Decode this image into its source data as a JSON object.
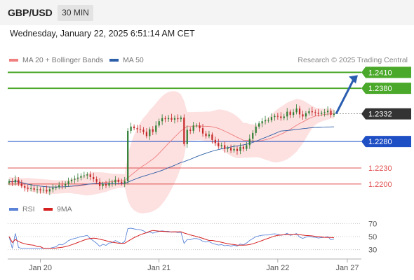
{
  "header": {
    "symbol": "GBP/USD",
    "timeframe": "30 MIN"
  },
  "datetime": "Wednesday, January 22, 2025 6:51:14 AM CET",
  "legend": {
    "ma20_label": "MA 20 + Bollinger Bands",
    "ma50_label": "MA 50",
    "rsi_label": "RSI",
    "rsi_ma_label": "9MA"
  },
  "copyright": "Research © 2025 Trading Central",
  "colors": {
    "ma20": "#f08080",
    "ma50": "#2d5fa8",
    "bollinger_fill": "#fde0e0",
    "resistance": "#4aa82a",
    "support": "#1f4fc4",
    "support_red": "#e05050",
    "current": "#333333",
    "rsi": "#5b84d8",
    "rsi_ma": "#d62020",
    "candle_up": "#2e7d32",
    "candle_down": "#c62828",
    "arrow": "#2a5db0"
  },
  "chart_data": [
    {
      "type": "candlestick",
      "title": "GBP/USD 30 MIN",
      "x_labels": [
        "Jan 20",
        "Jan 21",
        "Jan 22",
        "Jan 27"
      ],
      "ylim": [
        1.218,
        1.2425
      ],
      "series": [
        {
          "name": "GBP/USD",
          "close": [
            1.2205,
            1.2203,
            1.2208,
            1.2201,
            1.2196,
            1.2193,
            1.2191,
            1.2192,
            1.2189,
            1.219,
            1.2188,
            1.2189,
            1.2186,
            1.219,
            1.2193,
            1.2194,
            1.2198,
            1.2197,
            1.22,
            1.2205,
            1.2208,
            1.221,
            1.2212,
            1.2215,
            1.2216,
            1.2218,
            1.2213,
            1.2209,
            1.2204,
            1.2196,
            1.22,
            1.2197,
            1.2202,
            1.2203,
            1.2208,
            1.2204,
            1.2201,
            1.2205,
            1.23,
            1.2308,
            1.2305,
            1.2303,
            1.2302,
            1.2298,
            1.229,
            1.2303,
            1.2298,
            1.231,
            1.2318,
            1.2324,
            1.2322,
            1.2324,
            1.2321,
            1.2324,
            1.2322,
            1.2325,
            1.2275,
            1.2302,
            1.23,
            1.231,
            1.231,
            1.2305,
            1.2295,
            1.229,
            1.2293,
            1.2283,
            1.2277,
            1.2271,
            1.2273,
            1.2266,
            1.2268,
            1.2263,
            1.2266,
            1.2262,
            1.227,
            1.2266,
            1.2273,
            1.2285,
            1.2296,
            1.2308,
            1.2314,
            1.2318,
            1.232,
            1.232,
            1.2326,
            1.2328,
            1.2327,
            1.2324,
            1.2327,
            1.2336,
            1.233,
            1.2335,
            1.2342,
            1.2331,
            1.2327,
            1.2333,
            1.2337,
            1.2335,
            1.2334,
            1.2332,
            1.2334,
            1.2335,
            1.2338,
            1.233,
            1.2332
          ]
        },
        {
          "name": "MA 20"
        },
        {
          "name": "MA 50"
        }
      ],
      "levels": [
        {
          "price": "1.2410",
          "kind": "resistance"
        },
        {
          "price": "1.2380",
          "kind": "resistance"
        },
        {
          "price": "1.2332",
          "kind": "current"
        },
        {
          "price": "1.2280",
          "kind": "pivot"
        },
        {
          "price": "1.2230",
          "kind": "support"
        },
        {
          "price": "1.2200",
          "kind": "support"
        }
      ]
    },
    {
      "type": "line",
      "ylim": [
        20,
        80
      ],
      "yticks": [
        "70",
        "50",
        "30"
      ],
      "series": [
        {
          "name": "RSI"
        },
        {
          "name": "9MA"
        }
      ]
    }
  ]
}
